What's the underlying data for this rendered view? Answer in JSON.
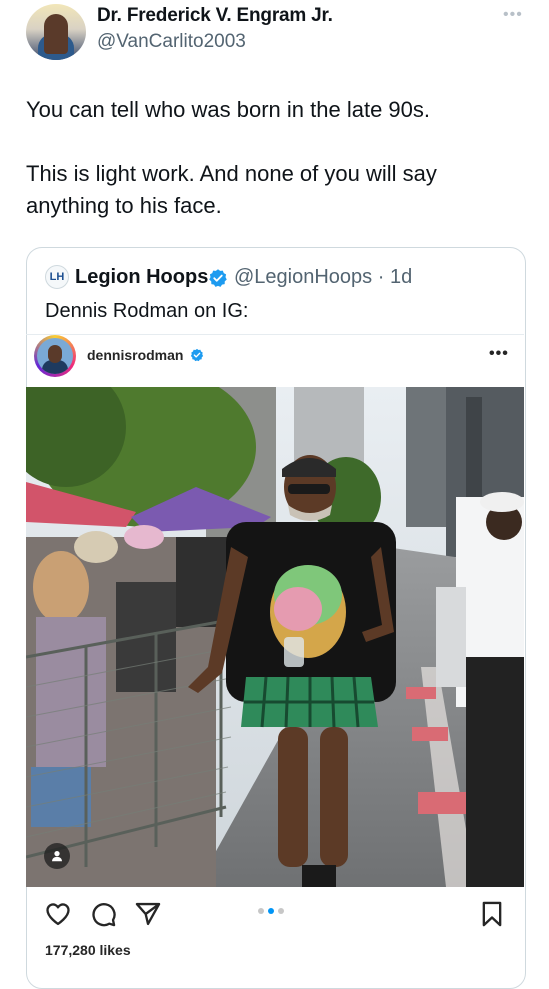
{
  "tweet": {
    "display_name": "Dr. Frederick V. Engram Jr.",
    "handle": "@VanCarlito2003",
    "more_icon": "more-horizontal-icon",
    "text": "You can tell who was born in the late 90s.\n\nThis is light work. And none of you will say anything to his face."
  },
  "quote": {
    "logo_text": "LH",
    "name": "Legion Hoops",
    "handle": "@LegionHoops",
    "separator": " · ",
    "time": "1d",
    "text": "Dennis Rodman on IG:"
  },
  "instagram": {
    "username": "dennisrodman",
    "likes": "177,280 likes",
    "carousel": {
      "count": 3,
      "active_index": 1
    },
    "colors": {
      "accent": "#0095f6",
      "verified": "#1d9bf0"
    }
  }
}
